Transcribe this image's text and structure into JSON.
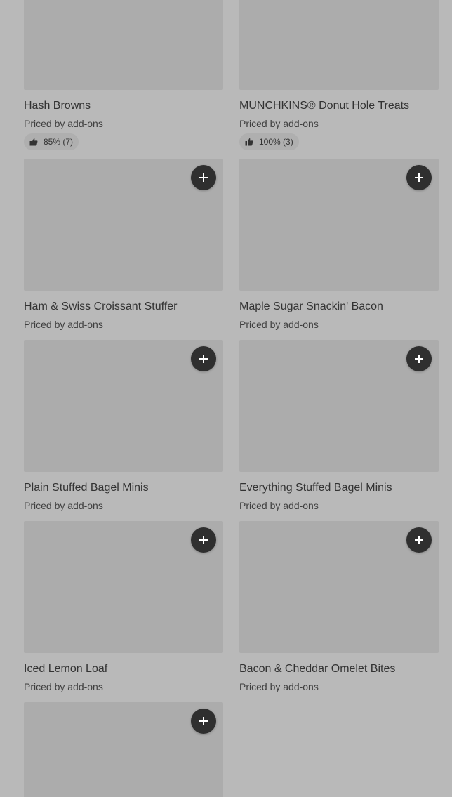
{
  "items": [
    {
      "title": "Hash Browns",
      "subtitle": "Priced by add-ons",
      "rating": "85% (7)"
    },
    {
      "title": "MUNCHKINS® Donut Hole Treats",
      "subtitle": "Priced by add-ons",
      "rating": "100% (3)"
    },
    {
      "title": "Ham & Swiss Croissant Stuffer",
      "subtitle": "Priced by add-ons"
    },
    {
      "title": "Maple Sugar Snackin' Bacon",
      "subtitle": "Priced by add-ons"
    },
    {
      "title": "Plain Stuffed Bagel Minis",
      "subtitle": "Priced by add-ons"
    },
    {
      "title": "Everything Stuffed Bagel Minis",
      "subtitle": "Priced by add-ons"
    },
    {
      "title": "Iced Lemon Loaf",
      "subtitle": "Priced by add-ons"
    },
    {
      "title": "Bacon & Cheddar Omelet Bites",
      "subtitle": "Priced by add-ons"
    }
  ],
  "icons": {
    "add": "plus-icon",
    "rating": "thumbs-up-icon"
  },
  "colors": {
    "background": "#b9b9b9",
    "thumbnail": "#acacac",
    "add_button": "#2f2f2f",
    "text": "#333333"
  }
}
